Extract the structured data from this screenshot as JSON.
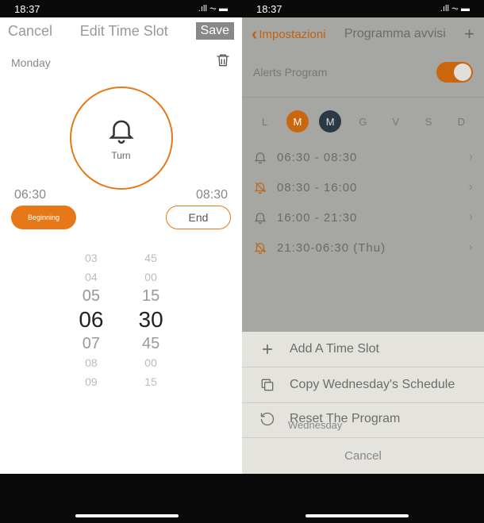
{
  "status": {
    "time": "18:37",
    "extra": ".ıll ⏦ ▬"
  },
  "left": {
    "header": {
      "cancel": "Cancel",
      "title": "Edit Time Slot",
      "save": "Save"
    },
    "day": "Monday",
    "circle_label": "Turn",
    "start_time": "06:30",
    "end_time": "08:30",
    "begin_btn": "Beginning",
    "end_btn": "End",
    "picker": {
      "hours": [
        "03",
        "04",
        "05",
        "06",
        "07",
        "08",
        "09"
      ],
      "mins": [
        "45",
        "00",
        "15",
        "30",
        "45",
        "00",
        "15"
      ]
    }
  },
  "right": {
    "header": {
      "back": "Impostazioni",
      "title": "Programma avvisi",
      "plus": "+"
    },
    "alerts_label": "Alerts Program",
    "days": [
      "L",
      "M",
      "M",
      "G",
      "V",
      "S",
      "D"
    ],
    "slots": [
      {
        "time": "06:30 - 08:30",
        "strike": false
      },
      {
        "time": "08:30 - 16:00",
        "strike": true
      },
      {
        "time": "16:00 - 21:30",
        "strike": false
      },
      {
        "time": "21:30-06:30 (Thu)",
        "strike": true
      }
    ],
    "sheet": {
      "add": "Add A Time Slot",
      "copy": "Copy Wednesday's Schedule",
      "reset_title": "Reset The Program",
      "reset_sub": "Wednesday",
      "cancel": "Cancel"
    }
  }
}
